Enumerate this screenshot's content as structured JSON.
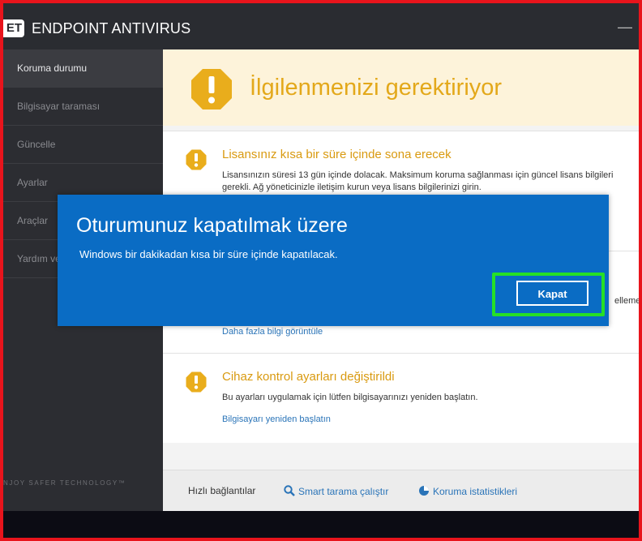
{
  "app": {
    "logo_text": "ET",
    "title": "ENDPOINT ANTIVIRUS",
    "minimize_label": "—",
    "tagline": "NJOY SAFER TECHNOLOGY™"
  },
  "sidebar": {
    "items": [
      {
        "label": "Koruma durumu",
        "active": true
      },
      {
        "label": "Bilgisayar taraması"
      },
      {
        "label": "Güncelle"
      },
      {
        "label": "Ayarlar"
      },
      {
        "label": "Araçlar"
      },
      {
        "label": "Yardım ve destek"
      }
    ]
  },
  "main": {
    "banner_title": "İlgilenmenizi gerektiriyor",
    "cards": [
      {
        "title": "Lisansınız kısa bir süre içinde sona erecek",
        "text": "Lisansınızın süresi 13 gün içinde dolacak. Maksimum koruma sağlanması için güncel lisans bilgileri gerekli. Ağ yöneticinizle iletişim kurun veya lisans bilgilerinizi girin."
      },
      {
        "partial_text": "ellemel",
        "link": "Daha fazla bilgi görüntüle"
      },
      {
        "title": "Cihaz kontrol ayarları değiştirildi",
        "text": "Bu ayarları uygulamak için lütfen bilgisayarınızı yeniden başlatın.",
        "link": "Bilgisayarı yeniden başlatın"
      }
    ]
  },
  "quick_links": {
    "label": "Hızlı bağlantılar",
    "smart_scan": "Smart tarama çalıştır",
    "stats": "Koruma istatistikleri"
  },
  "dialog": {
    "title": "Oturumunuz kapatılmak üzere",
    "message": "Windows bir dakikadan kısa bir süre içinde kapatılacak.",
    "close_label": "Kapat"
  },
  "colors": {
    "frame_border": "#e8141c",
    "dialog_bg": "#0a6cc4",
    "highlight": "#26e026",
    "warning": "#e3a81a",
    "link": "#2a74b8"
  }
}
